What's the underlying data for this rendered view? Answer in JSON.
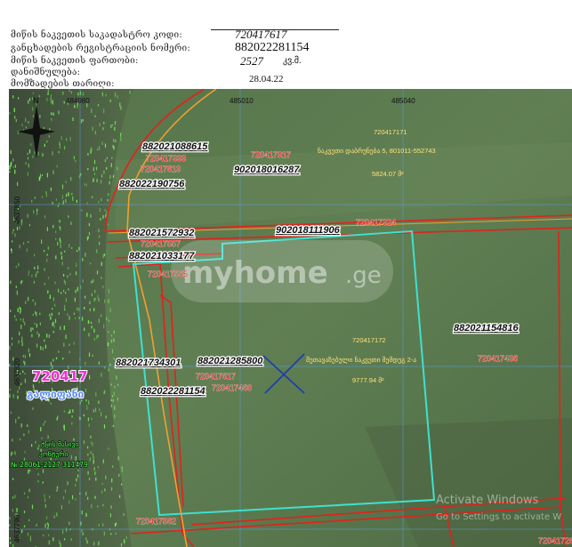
{
  "header": {
    "rows": [
      {
        "label": "მიწის ნაკვეთის საკადასტრო კოდი:",
        "value": "720417617"
      },
      {
        "label": "განცხადების რეგისტრაციის ნომერი:",
        "value": "882022281154"
      },
      {
        "label": "მიწის ნაკვეთის ფართობი:",
        "value": "2527",
        "unit": "კვ.მ."
      },
      {
        "label": "დანიშნულება:",
        "value": ""
      },
      {
        "label": "მომზადების თარიღი:",
        "value": "28.04.22"
      }
    ]
  },
  "map": {
    "coord_top": [
      "484980",
      "485010",
      "485040"
    ],
    "coord_left": [
      "4637850",
      "4637820",
      "4637790"
    ],
    "north_label": "N",
    "parcel_numbers": [
      "882021088615",
      "882022190756",
      "902018016287",
      "902018111906",
      "882021572932",
      "882021033177",
      "882021734301",
      "882021285800",
      "882022281154",
      "882021154816"
    ],
    "parcel_codes_red": [
      "720417333",
      "720417613",
      "720417317",
      "720417324",
      "720417557",
      "720417565",
      "720417617",
      "720417468",
      "720417436",
      "720417562",
      "720417268"
    ],
    "yellow_labels": [
      "720417171",
      "720417172",
      "5824.07 მ²",
      "9777.94 მ²"
    ],
    "yellow_desc_1": "ნაკვეთი დაბრუნება 5, 801011-552743",
    "yellow_desc_2": "შეთავაზებული ნაკვეთი შემდეგ 2-ა",
    "zone_code": "720417",
    "zone_name": "გალიფანი",
    "green_text_1": "ტყის მასივი",
    "green_text_2": "კონტური",
    "green_text_3": "№ 28061-2127 311479",
    "watermark": "myhome",
    "watermark_suffix": ".ge",
    "activate_title": "Activate Windows",
    "activate_sub": "Go to Settings to activate W",
    "colors": {
      "parcel_red": "#e3211c",
      "boundary_cyan": "#3fe0d0",
      "orange_line": "#f0a030",
      "grid_blue": "#5aa0e0",
      "zone_magenta": "#ff2ad2",
      "zone_blue": "#5c8cff",
      "label_yellow": "#ffe27a",
      "green_text": "#4cff4c"
    }
  }
}
